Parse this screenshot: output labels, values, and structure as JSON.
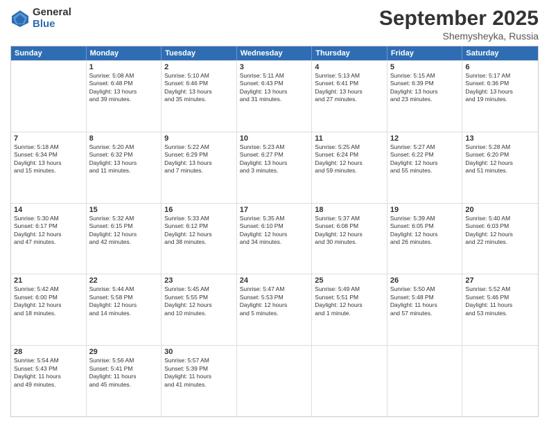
{
  "logo": {
    "general": "General",
    "blue": "Blue"
  },
  "title": "September 2025",
  "location": "Shemysheyka, Russia",
  "weekdays": [
    "Sunday",
    "Monday",
    "Tuesday",
    "Wednesday",
    "Thursday",
    "Friday",
    "Saturday"
  ],
  "weeks": [
    [
      {
        "day": "",
        "info": ""
      },
      {
        "day": "1",
        "info": "Sunrise: 5:08 AM\nSunset: 6:48 PM\nDaylight: 13 hours\nand 39 minutes."
      },
      {
        "day": "2",
        "info": "Sunrise: 5:10 AM\nSunset: 6:46 PM\nDaylight: 13 hours\nand 35 minutes."
      },
      {
        "day": "3",
        "info": "Sunrise: 5:11 AM\nSunset: 6:43 PM\nDaylight: 13 hours\nand 31 minutes."
      },
      {
        "day": "4",
        "info": "Sunrise: 5:13 AM\nSunset: 6:41 PM\nDaylight: 13 hours\nand 27 minutes."
      },
      {
        "day": "5",
        "info": "Sunrise: 5:15 AM\nSunset: 6:39 PM\nDaylight: 13 hours\nand 23 minutes."
      },
      {
        "day": "6",
        "info": "Sunrise: 5:17 AM\nSunset: 6:36 PM\nDaylight: 13 hours\nand 19 minutes."
      }
    ],
    [
      {
        "day": "7",
        "info": "Sunrise: 5:18 AM\nSunset: 6:34 PM\nDaylight: 13 hours\nand 15 minutes."
      },
      {
        "day": "8",
        "info": "Sunrise: 5:20 AM\nSunset: 6:32 PM\nDaylight: 13 hours\nand 11 minutes."
      },
      {
        "day": "9",
        "info": "Sunrise: 5:22 AM\nSunset: 6:29 PM\nDaylight: 13 hours\nand 7 minutes."
      },
      {
        "day": "10",
        "info": "Sunrise: 5:23 AM\nSunset: 6:27 PM\nDaylight: 13 hours\nand 3 minutes."
      },
      {
        "day": "11",
        "info": "Sunrise: 5:25 AM\nSunset: 6:24 PM\nDaylight: 12 hours\nand 59 minutes."
      },
      {
        "day": "12",
        "info": "Sunrise: 5:27 AM\nSunset: 6:22 PM\nDaylight: 12 hours\nand 55 minutes."
      },
      {
        "day": "13",
        "info": "Sunrise: 5:28 AM\nSunset: 6:20 PM\nDaylight: 12 hours\nand 51 minutes."
      }
    ],
    [
      {
        "day": "14",
        "info": "Sunrise: 5:30 AM\nSunset: 6:17 PM\nDaylight: 12 hours\nand 47 minutes."
      },
      {
        "day": "15",
        "info": "Sunrise: 5:32 AM\nSunset: 6:15 PM\nDaylight: 12 hours\nand 42 minutes."
      },
      {
        "day": "16",
        "info": "Sunrise: 5:33 AM\nSunset: 6:12 PM\nDaylight: 12 hours\nand 38 minutes."
      },
      {
        "day": "17",
        "info": "Sunrise: 5:35 AM\nSunset: 6:10 PM\nDaylight: 12 hours\nand 34 minutes."
      },
      {
        "day": "18",
        "info": "Sunrise: 5:37 AM\nSunset: 6:08 PM\nDaylight: 12 hours\nand 30 minutes."
      },
      {
        "day": "19",
        "info": "Sunrise: 5:39 AM\nSunset: 6:05 PM\nDaylight: 12 hours\nand 26 minutes."
      },
      {
        "day": "20",
        "info": "Sunrise: 5:40 AM\nSunset: 6:03 PM\nDaylight: 12 hours\nand 22 minutes."
      }
    ],
    [
      {
        "day": "21",
        "info": "Sunrise: 5:42 AM\nSunset: 6:00 PM\nDaylight: 12 hours\nand 18 minutes."
      },
      {
        "day": "22",
        "info": "Sunrise: 5:44 AM\nSunset: 5:58 PM\nDaylight: 12 hours\nand 14 minutes."
      },
      {
        "day": "23",
        "info": "Sunrise: 5:45 AM\nSunset: 5:55 PM\nDaylight: 12 hours\nand 10 minutes."
      },
      {
        "day": "24",
        "info": "Sunrise: 5:47 AM\nSunset: 5:53 PM\nDaylight: 12 hours\nand 5 minutes."
      },
      {
        "day": "25",
        "info": "Sunrise: 5:49 AM\nSunset: 5:51 PM\nDaylight: 12 hours\nand 1 minute."
      },
      {
        "day": "26",
        "info": "Sunrise: 5:50 AM\nSunset: 5:48 PM\nDaylight: 11 hours\nand 57 minutes."
      },
      {
        "day": "27",
        "info": "Sunrise: 5:52 AM\nSunset: 5:46 PM\nDaylight: 11 hours\nand 53 minutes."
      }
    ],
    [
      {
        "day": "28",
        "info": "Sunrise: 5:54 AM\nSunset: 5:43 PM\nDaylight: 11 hours\nand 49 minutes."
      },
      {
        "day": "29",
        "info": "Sunrise: 5:56 AM\nSunset: 5:41 PM\nDaylight: 11 hours\nand 45 minutes."
      },
      {
        "day": "30",
        "info": "Sunrise: 5:57 AM\nSunset: 5:39 PM\nDaylight: 11 hours\nand 41 minutes."
      },
      {
        "day": "",
        "info": ""
      },
      {
        "day": "",
        "info": ""
      },
      {
        "day": "",
        "info": ""
      },
      {
        "day": "",
        "info": ""
      }
    ]
  ]
}
